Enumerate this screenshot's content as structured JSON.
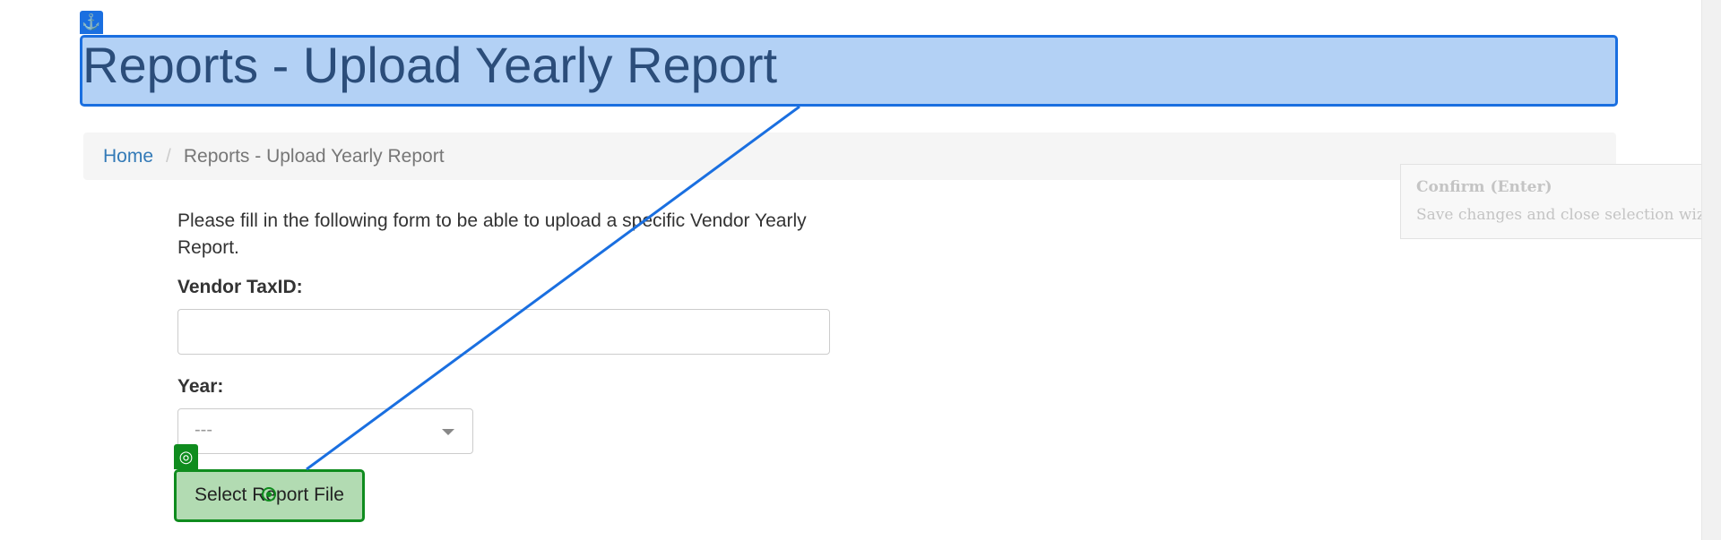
{
  "header": {
    "title": "Reports - Upload Yearly Report",
    "anchor_icon": "anchor-icon",
    "highlight_color": "#1a6fe0"
  },
  "breadcrumb": {
    "home": "Home",
    "separator": "/",
    "current": "Reports - Upload Yearly Report"
  },
  "form": {
    "intro": "Please fill in the following form to be able to upload a specific Vendor Yearly Report.",
    "vendor_label": "Vendor TaxID:",
    "vendor_value": "",
    "year_label": "Year:",
    "year_selected": "---",
    "submit_label": "Select Report File"
  },
  "overlay": {
    "target_icon": "target-icon",
    "target_color": "#0f8c1e"
  },
  "tooltip": {
    "title": "Confirm (Enter)",
    "description": "Save changes and close selection wizard."
  }
}
